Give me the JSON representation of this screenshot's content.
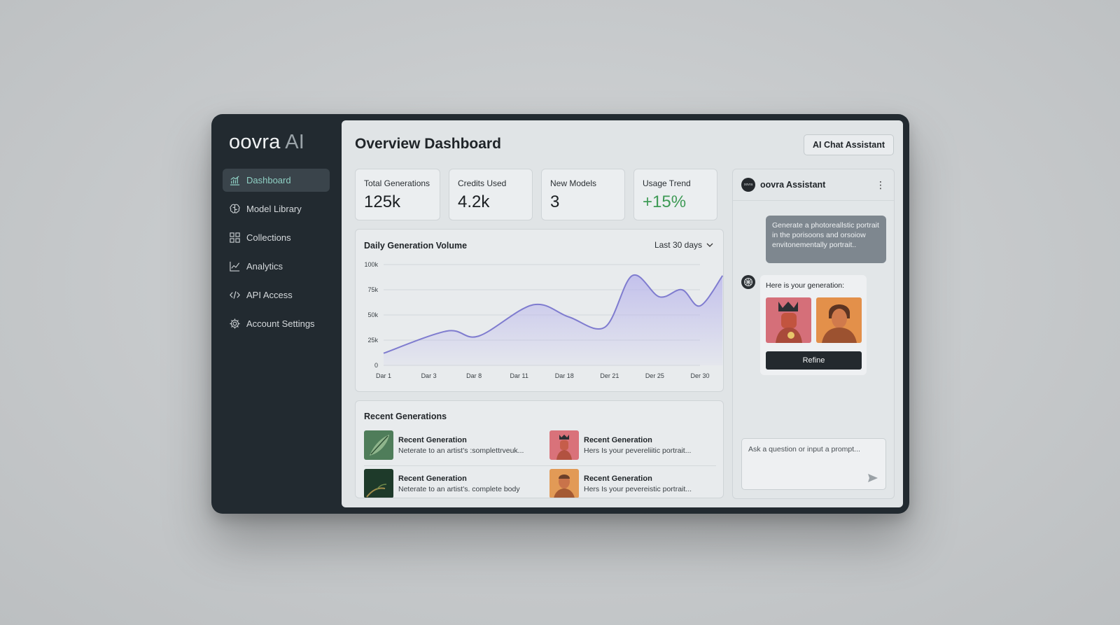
{
  "app": {
    "logo_main": "oovra",
    "logo_suffix": " AI"
  },
  "sidebar": {
    "items": [
      {
        "label": "Dashboard",
        "icon": "chart-bars-icon",
        "active": true
      },
      {
        "label": "Model Library",
        "icon": "brain-icon"
      },
      {
        "label": "Collections",
        "icon": "grid-icon"
      },
      {
        "label": "Analytics",
        "icon": "line-chart-icon"
      },
      {
        "label": "API Access",
        "icon": "code-icon"
      },
      {
        "label": "Account Settings",
        "icon": "gear-icon"
      }
    ]
  },
  "header": {
    "title": "Overview Dashboard",
    "chat_button": "AI Chat Assistant"
  },
  "stats": [
    {
      "label": "Total Generations",
      "value": "125k"
    },
    {
      "label": "Credits Used",
      "value": "4.2k"
    },
    {
      "label": "New Models",
      "value": "3"
    },
    {
      "label": "Usage Trend",
      "value": "+15%",
      "color": "#3e9a55"
    }
  ],
  "chart_card": {
    "range_label": "Last 30 days"
  },
  "chart_data": {
    "type": "area",
    "title": "Daily Generation Volume",
    "x_labels": [
      "Dar 1",
      "Dar 3",
      "Dar 8",
      "Dar 11",
      "Dar 18",
      "Der 21",
      "Der 25",
      "Der 30"
    ],
    "y_ticks": [
      "0",
      "25k",
      "50k",
      "75k",
      "100k"
    ],
    "ylim": [
      0,
      100000
    ],
    "x": [
      0,
      1.4,
      2.1,
      3.3,
      4.1,
      4.9,
      5.5,
      6.1,
      6.6,
      7.0,
      7.5
    ],
    "y": [
      12000,
      34000,
      29000,
      60000,
      48000,
      38000,
      89000,
      68000,
      75000,
      59000,
      89000
    ],
    "grid": true,
    "line_color": "#7f7ccf",
    "fill_color": "#b7b3ec"
  },
  "recent": {
    "title": "Recent Generations",
    "items": [
      {
        "title": "Recent Generation",
        "desc": "Neterate to an artist's :somplettrveuk..."
      },
      {
        "title": "Recent Generation",
        "desc": "Hers Is your pevereliitic portrait..."
      },
      {
        "title": "Recent Generation",
        "desc": "Neterate to an artist's. complete body"
      },
      {
        "title": "Recent Generation",
        "desc": "Hers Is your pevereistic portrait..."
      }
    ]
  },
  "chat": {
    "assistant_name": "oovra Assistant",
    "avatar_text": "oovra",
    "user_message": "Generate a photoreallstic portrait in the porisoons and orsoiow envitonementally portrait..",
    "bot_message": "Here is your generation:",
    "refine_label": "Refine",
    "input_placeholder": "Ask a question or input a prompt..."
  }
}
